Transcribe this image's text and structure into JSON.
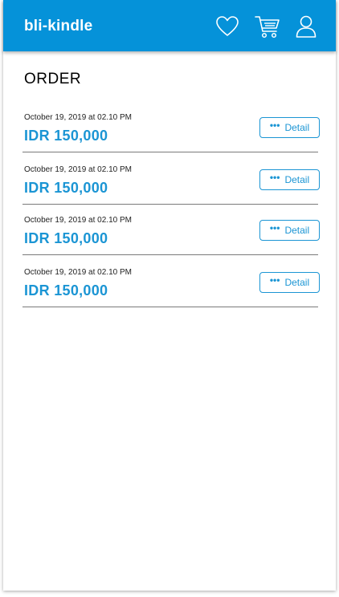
{
  "app": {
    "brand": "bli-kindle"
  },
  "header": {
    "icons": [
      "heart-icon",
      "cart-icon",
      "user-icon"
    ]
  },
  "page": {
    "title": "ORDER"
  },
  "orders": [
    {
      "date": "October 19, 2019 at 02.10 PM",
      "amount": "IDR 150,000",
      "detail_label": "Detail",
      "dots": "•••"
    },
    {
      "date": "October 19, 2019 at 02.10 PM",
      "amount": "IDR 150,000",
      "detail_label": "Detail",
      "dots": "•••"
    },
    {
      "date": "October 19, 2019 at 02.10 PM",
      "amount": "IDR 150,000",
      "detail_label": "Detail",
      "dots": "•••"
    },
    {
      "date": "October 19, 2019 at 02.10 PM",
      "amount": "IDR 150,000",
      "detail_label": "Detail",
      "dots": "•••"
    }
  ],
  "colors": {
    "appbar": "#0592d9",
    "accent": "#1b95d4",
    "divider": "#7a7a7a"
  }
}
